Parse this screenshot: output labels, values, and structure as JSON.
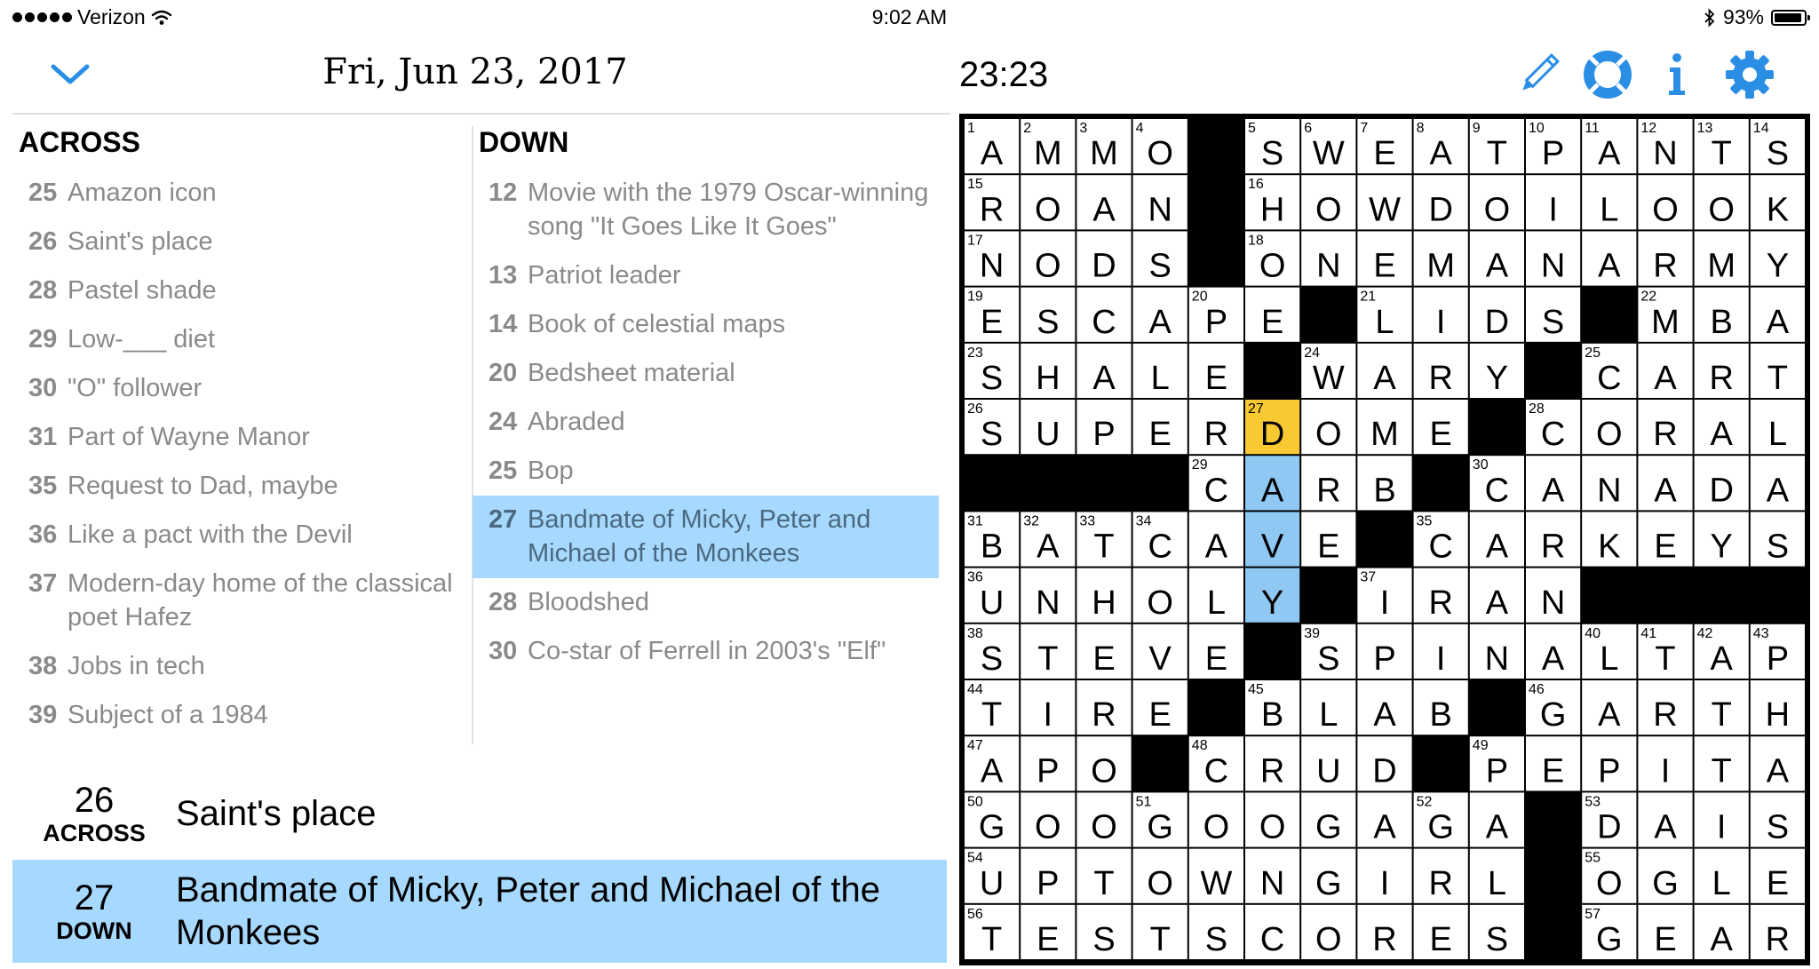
{
  "status_bar": {
    "carrier": "Verizon",
    "time": "9:02 AM",
    "battery": "93%",
    "battery_level": 0.93,
    "icons": [
      "signal-dots-icon",
      "wifi-icon",
      "bluetooth-icon",
      "battery-icon"
    ]
  },
  "header": {
    "date": "Fri, Jun 23, 2017",
    "timer": "23:23",
    "icons": [
      "chevron-down-icon",
      "pencil-icon",
      "help-lifebuoy-icon",
      "info-icon",
      "gear-icon"
    ]
  },
  "colors": {
    "accent": "#2a8ee5",
    "selected_word": "#a7d8fd",
    "selected_cell": "#f8c932",
    "clue_text": "#8a8a8a",
    "black_square": "#000000"
  },
  "across": {
    "title": "ACROSS",
    "clues": [
      {
        "num": "25",
        "text": "Amazon icon"
      },
      {
        "num": "26",
        "text": "Saint's place",
        "current": true
      },
      {
        "num": "28",
        "text": "Pastel shade"
      },
      {
        "num": "29",
        "text": "Low-___ diet"
      },
      {
        "num": "30",
        "text": "\"O\" follower"
      },
      {
        "num": "31",
        "text": "Part of Wayne Manor"
      },
      {
        "num": "35",
        "text": "Request to Dad, maybe"
      },
      {
        "num": "36",
        "text": "Like a pact with the Devil"
      },
      {
        "num": "37",
        "text": "Modern-day home of the classical poet Hafez"
      },
      {
        "num": "38",
        "text": "Jobs in tech"
      },
      {
        "num": "39",
        "text": "Subject of a 1984"
      }
    ]
  },
  "down": {
    "title": "DOWN",
    "clues": [
      {
        "num": "12",
        "text": "Movie with the 1979 Oscar-winning song \"It Goes Like It Goes\""
      },
      {
        "num": "13",
        "text": "Patriot leader"
      },
      {
        "num": "14",
        "text": "Book of celestial maps"
      },
      {
        "num": "20",
        "text": "Bedsheet material"
      },
      {
        "num": "24",
        "text": "Abraded"
      },
      {
        "num": "25",
        "text": "Bop"
      },
      {
        "num": "27",
        "text": "Bandmate of Micky, Peter and Michael of the Monkees",
        "selected": true
      },
      {
        "num": "28",
        "text": "Bloodshed"
      },
      {
        "num": "30",
        "text": "Co-star of Ferrell in 2003's \"Elf\""
      }
    ]
  },
  "clue_bar": [
    {
      "num": "26",
      "dir": "ACROSS",
      "text": "Saint's place"
    },
    {
      "num": "27",
      "dir": "DOWN",
      "text": "Bandmate of Micky, Peter and Michael of the Monkees"
    }
  ],
  "puzzle": {
    "rows": [
      "AMMO#SWEATPANTS",
      "ROAN#HOWDOILOOK",
      "NODS#ONEMANARMY",
      "ESCAPE#LIDS#MBA",
      "SHALE#WARY#CART",
      "SUPERDOME#CORAL",
      "####CARB#CANADA",
      "BATCAVE#CARKEYS",
      "UNHOLY#IRAN####",
      "STEVE#SPINALTAP",
      "TIRE#BLAB#GARTH",
      "APO#CRUD#PEPITA",
      "GOOGOOGAGA#DAIS",
      "UPTOWNGIRL#OGLE",
      "TESTSCORES#GEAR"
    ],
    "numbers": [
      [
        1,
        2,
        3,
        4,
        0,
        5,
        6,
        7,
        8,
        9,
        10,
        11,
        12,
        13,
        14
      ],
      [
        15,
        0,
        0,
        0,
        0,
        16,
        0,
        0,
        0,
        0,
        0,
        0,
        0,
        0,
        0
      ],
      [
        17,
        0,
        0,
        0,
        0,
        18,
        0,
        0,
        0,
        0,
        0,
        0,
        0,
        0,
        0
      ],
      [
        19,
        0,
        0,
        0,
        20,
        0,
        0,
        21,
        0,
        0,
        0,
        0,
        22,
        0,
        0
      ],
      [
        23,
        0,
        0,
        0,
        0,
        0,
        24,
        0,
        0,
        0,
        0,
        25,
        0,
        0,
        0
      ],
      [
        26,
        0,
        0,
        0,
        0,
        27,
        0,
        0,
        0,
        0,
        28,
        0,
        0,
        0,
        0
      ],
      [
        0,
        0,
        0,
        0,
        29,
        0,
        0,
        0,
        0,
        30,
        0,
        0,
        0,
        0,
        0
      ],
      [
        31,
        32,
        33,
        34,
        0,
        0,
        0,
        0,
        35,
        0,
        0,
        0,
        0,
        0,
        0
      ],
      [
        36,
        0,
        0,
        0,
        0,
        0,
        0,
        37,
        0,
        0,
        0,
        0,
        0,
        0,
        0
      ],
      [
        38,
        0,
        0,
        0,
        0,
        0,
        39,
        0,
        0,
        0,
        0,
        40,
        41,
        42,
        43
      ],
      [
        44,
        0,
        0,
        0,
        0,
        45,
        0,
        0,
        0,
        0,
        46,
        0,
        0,
        0,
        0
      ],
      [
        47,
        0,
        0,
        0,
        48,
        0,
        0,
        0,
        0,
        49,
        0,
        0,
        0,
        0,
        0
      ],
      [
        50,
        0,
        0,
        51,
        0,
        0,
        0,
        0,
        52,
        0,
        0,
        53,
        0,
        0,
        0
      ],
      [
        54,
        0,
        0,
        0,
        0,
        0,
        0,
        0,
        0,
        0,
        0,
        55,
        0,
        0,
        0
      ],
      [
        56,
        0,
        0,
        0,
        0,
        0,
        0,
        0,
        0,
        0,
        0,
        57,
        0,
        0,
        0
      ]
    ],
    "selected_cell": [
      5,
      5
    ],
    "highlighted_cells": [
      [
        6,
        5
      ],
      [
        7,
        5
      ],
      [
        8,
        5
      ]
    ]
  }
}
